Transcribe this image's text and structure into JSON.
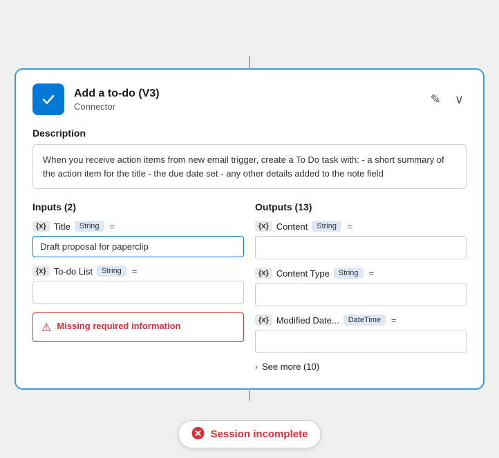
{
  "card": {
    "title": "Add a to-do (V3)",
    "subtitle": "Connector",
    "description": "When you receive action items from new email trigger, create a To Do task with: - a short summary of the action item for the title - the due date set - any other details added to the note field"
  },
  "inputs": {
    "section_title": "Inputs (2)",
    "fields": [
      {
        "icon": "{x}",
        "name": "Title",
        "type": "String",
        "value": "Draft proposal for paperclip",
        "has_value": true
      },
      {
        "icon": "{x}",
        "name": "To-do List",
        "type": "String",
        "value": "",
        "has_value": false
      }
    ],
    "error": {
      "text": "Missing required information"
    }
  },
  "outputs": {
    "section_title": "Outputs (13)",
    "fields": [
      {
        "icon": "{x}",
        "name": "Content",
        "type": "String",
        "value": ""
      },
      {
        "icon": "{x}",
        "name": "Content Type",
        "type": "String",
        "value": ""
      },
      {
        "icon": "{x}",
        "name": "Modified Date...",
        "type": "DateTime",
        "value": ""
      }
    ],
    "see_more": "See more (10)"
  },
  "session": {
    "text": "Session incomplete"
  },
  "icons": {
    "edit": "✎",
    "chevron_down": "∨",
    "error_triangle": "⚠",
    "chevron_right": "›",
    "error_circle": "✕"
  }
}
